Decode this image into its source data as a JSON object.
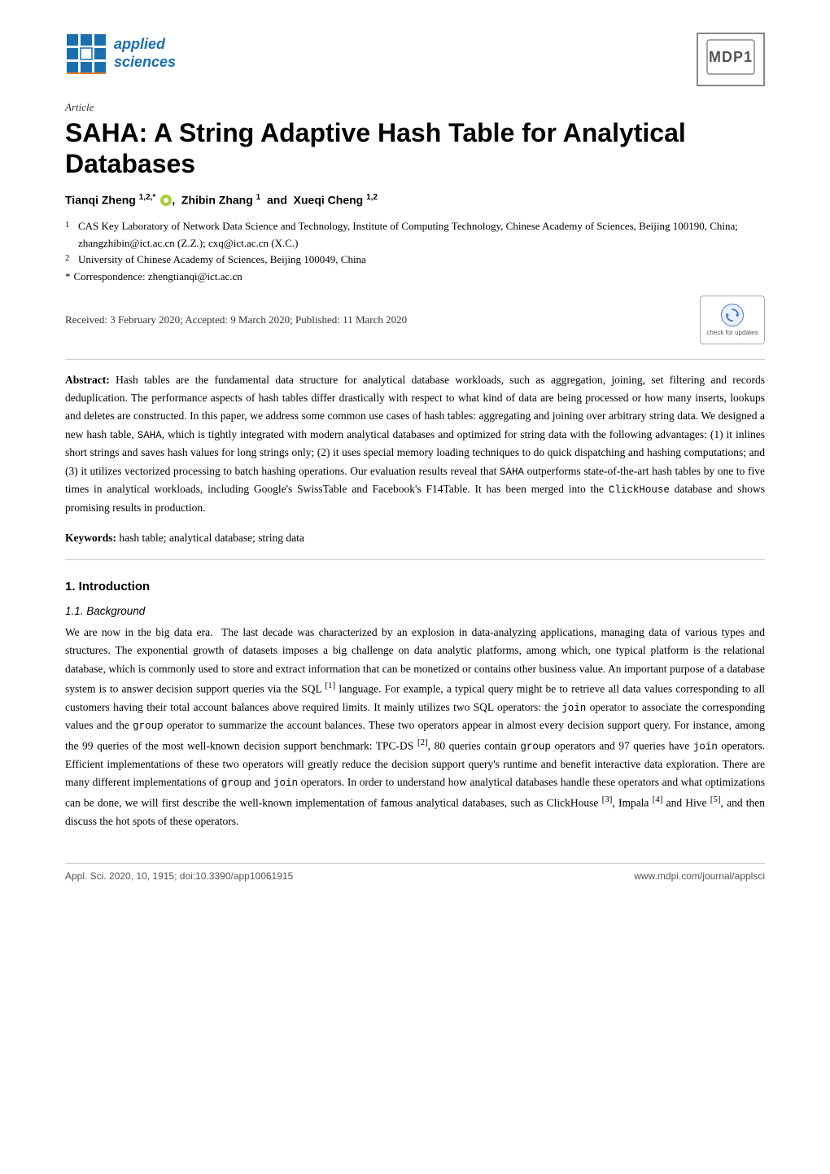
{
  "header": {
    "journal_name_line1": "applied",
    "journal_name_line2": "sciences",
    "mdpi_label": "MDP1",
    "article_type": "Article"
  },
  "paper": {
    "title": "SAHA: A String Adaptive Hash Table for Analytical Databases",
    "authors": "Tianqi Zheng 1,2,* , Zhibin Zhang 1 and Xueqi Cheng 1,2",
    "affiliation1": "CAS Key Laboratory of Network Data Science and Technology, Institute of Computing Technology, Chinese Academy of Sciences, Beijing 100190, China; zhangzhibin@ict.ac.cn (Z.Z.); cxq@ict.ac.cn (X.C.)",
    "affiliation2": "University of Chinese Academy of Sciences, Beijing 100049, China",
    "correspondence_label": "*",
    "correspondence_text": "Correspondence: zhengtianqi@ict.ac.cn",
    "dates": "Received: 3 February 2020; Accepted: 9 March 2020; Published: 11 March 2020",
    "check_for_updates": "check for updates"
  },
  "abstract": {
    "label": "Abstract:",
    "text": "Hash tables are the fundamental data structure for analytical database workloads, such as aggregation, joining, set filtering and records deduplication. The performance aspects of hash tables differ drastically with respect to what kind of data are being processed or how many inserts, lookups and deletes are constructed. In this paper, we address some common use cases of hash tables: aggregating and joining over arbitrary string data. We designed a new hash table, SAHA, which is tightly integrated with modern analytical databases and optimized for string data with the following advantages: (1) it inlines short strings and saves hash values for long strings only; (2) it uses special memory loading techniques to do quick dispatching and hashing computations; and (3) it utilizes vectorized processing to batch hashing operations. Our evaluation results reveal that SAHA outperforms state-of-the-art hash tables by one to five times in analytical workloads, including Google's SwissTable and Facebook's F14Table. It has been merged into the ClickHouse database and shows promising results in production."
  },
  "keywords": {
    "label": "Keywords:",
    "text": "hash table; analytical database; string data"
  },
  "section1": {
    "heading": "1. Introduction",
    "subsection1_heading": "1.1. Background",
    "paragraph1": "We are now in the big data era.  The last decade was characterized by an explosion in data-analyzing applications, managing data of various types and structures. The exponential growth of datasets imposes a big challenge on data analytic platforms, among which, one typical platform is the relational database, which is commonly used to store and extract information that can be monetized or contains other business value. An important purpose of a database system is to answer decision support queries via the SQL [1] language. For example, a typical query might be to retrieve all data values corresponding to all customers having their total account balances above required limits. It mainly utilizes two SQL operators: the join operator to associate the corresponding values and the group operator to summarize the account balances. These two operators appear in almost every decision support query. For instance, among the 99 queries of the most well-known decision support benchmark: TPC-DS [2], 80 queries contain group operators and 97 queries have join operators. Efficient implementations of these two operators will greatly reduce the decision support query's runtime and benefit interactive data exploration. There are many different implementations of group and join operators. In order to understand how analytical databases handle these operators and what optimizations can be done, we will first describe the well-known implementation of famous analytical databases, such as ClickHouse [3], Impala [4] and Hive [5], and then discuss the hot spots of these operators."
  },
  "footer": {
    "left": "Appl. Sci. 2020, 10, 1915; doi:10.3390/app10061915",
    "right": "www.mdpi.com/journal/applsci"
  }
}
